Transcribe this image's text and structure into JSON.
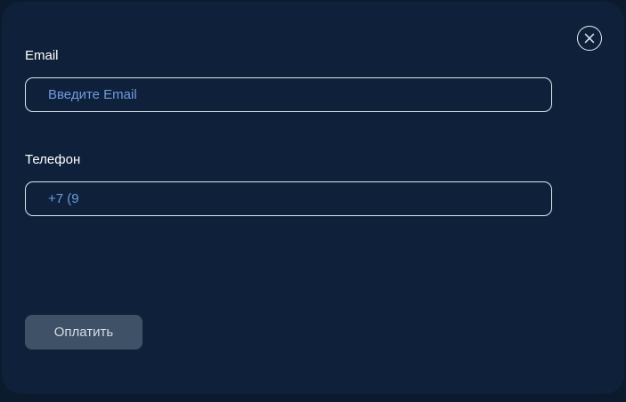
{
  "form": {
    "email": {
      "label": "Email",
      "value": "",
      "placeholder": "Введите Email"
    },
    "phone": {
      "label": "Телефон",
      "value": "+7 (9",
      "placeholder": ""
    },
    "pay_button_label": "Оплатить"
  },
  "close_icon": "close-icon",
  "colors": {
    "page_background": "#0b1a2c",
    "modal_background": "#0f213a",
    "input_text": "#6f9ae0",
    "button_background": "#3f5166",
    "button_text": "#d5dce6"
  }
}
